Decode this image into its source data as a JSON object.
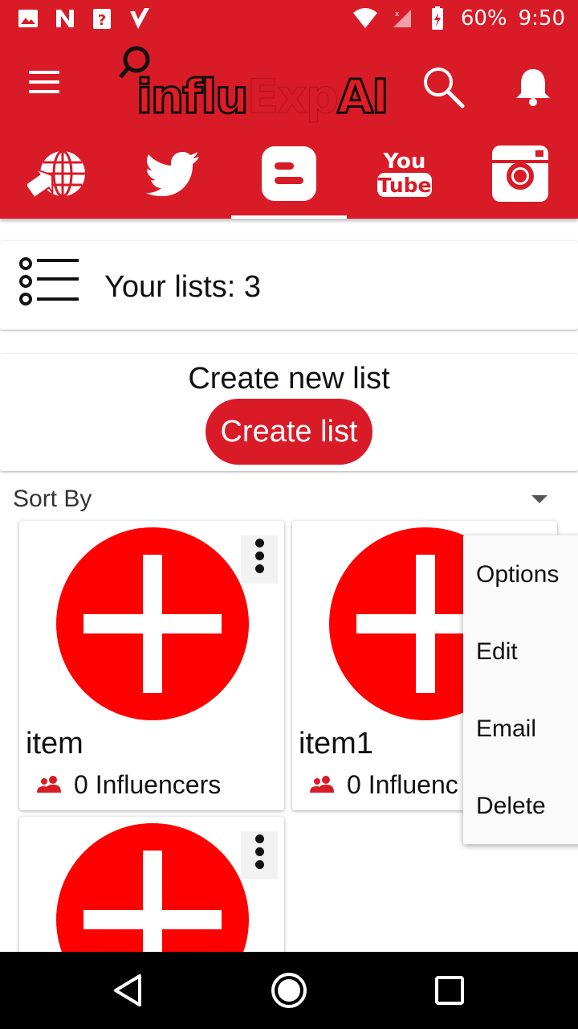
{
  "status_bar": {
    "battery": "60%",
    "time": "9:50",
    "icons_left": [
      "image-icon",
      "n-icon",
      "help-box-icon",
      "check-badge-icon"
    ],
    "icons_right": [
      "wifi-icon",
      "signal-icon",
      "battery-charging-icon"
    ]
  },
  "app_bar": {
    "logo": {
      "part1": "influ",
      "part2": "Exp",
      "part3": "AI"
    },
    "icons": [
      "menu-icon",
      "search-icon",
      "bell-icon"
    ]
  },
  "tabs": [
    {
      "name": "web",
      "icon": "globe-icon",
      "active": false
    },
    {
      "name": "twitter",
      "icon": "twitter-icon",
      "active": false
    },
    {
      "name": "blogger",
      "icon": "blogger-icon",
      "active": true
    },
    {
      "name": "youtube",
      "icon": "youtube-icon",
      "active": false,
      "lines": [
        "You",
        "Tube"
      ]
    },
    {
      "name": "instagram",
      "icon": "instagram-icon",
      "active": false
    }
  ],
  "lists_summary": {
    "label": "Your lists: 3"
  },
  "create_section": {
    "title": "Create new list",
    "button": "Create list"
  },
  "sort": {
    "label": "Sort By"
  },
  "items": [
    {
      "name": "item",
      "count": "0 Influencers"
    },
    {
      "name": "item1",
      "count": "0 Influenc"
    },
    {
      "name": "",
      "count": ""
    }
  ],
  "popup_menu": {
    "items": [
      "Options",
      "Edit",
      "Email",
      "Delete"
    ]
  },
  "colors": {
    "primary": "#d81b27",
    "accent_red": "#ff0000",
    "background": "#ffffff"
  }
}
